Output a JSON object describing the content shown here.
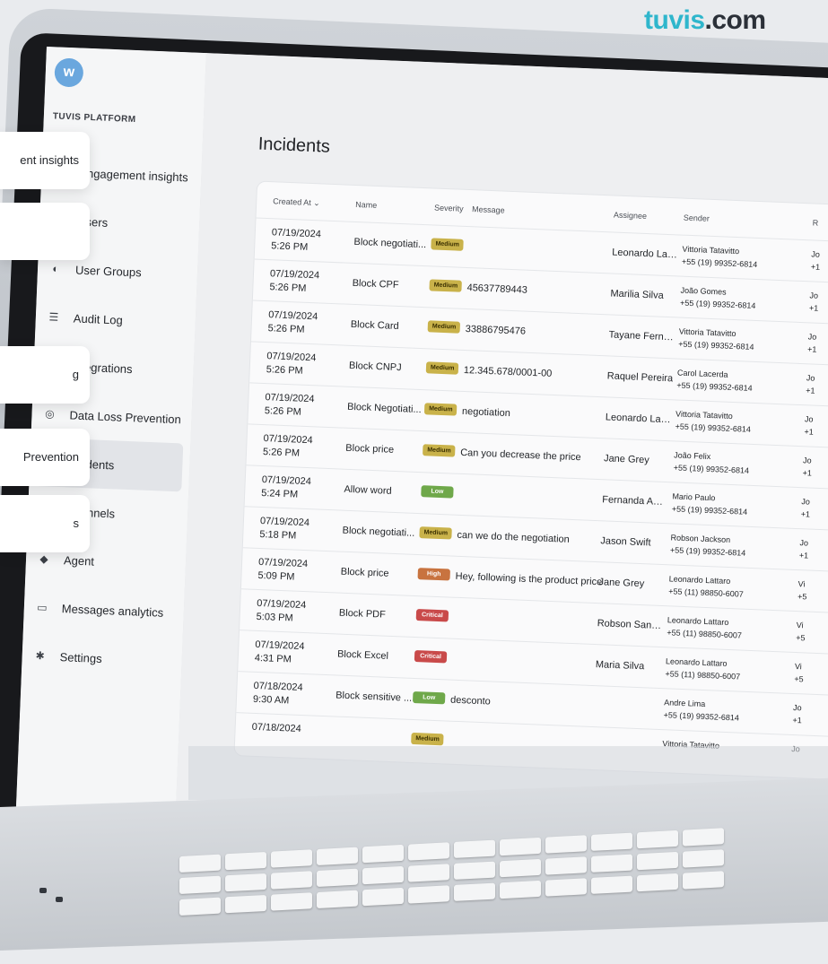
{
  "brand": {
    "part1": "tuvis",
    "part2": ".com"
  },
  "app": {
    "logo_glyph": "w",
    "platform": "TUVIS PLATFORM"
  },
  "nav": [
    {
      "icon": "chart-icon",
      "glyph": "▥",
      "label": "Engagement insights"
    },
    {
      "icon": "user-icon",
      "glyph": "●",
      "label": "Users"
    },
    {
      "icon": "users-icon",
      "glyph": "◐",
      "label": "User Groups"
    },
    {
      "icon": "list-icon",
      "glyph": "☰",
      "label": "Audit Log"
    },
    {
      "icon": "plug-icon",
      "glyph": "⊞",
      "label": "Integrations"
    },
    {
      "icon": "shield-icon",
      "glyph": "◎",
      "label": "Data Loss Prevention"
    },
    {
      "icon": "alert-icon",
      "glyph": "⚠",
      "label": "Incidents"
    },
    {
      "icon": "channel-icon",
      "glyph": "◇",
      "label": "Channels"
    },
    {
      "icon": "agent-icon",
      "glyph": "◆",
      "label": "Agent"
    },
    {
      "icon": "messages-icon",
      "glyph": "▭",
      "label": "Messages analytics"
    },
    {
      "icon": "gear-icon",
      "glyph": "✱",
      "label": "Settings"
    }
  ],
  "floats": [
    {
      "label": "ent insights"
    },
    {
      "label": ""
    },
    {
      "label": "g"
    },
    {
      "label": "Prevention"
    },
    {
      "label": "s"
    }
  ],
  "page": {
    "title": "Incidents"
  },
  "table": {
    "headers": {
      "created": "Created At ⌄",
      "name": "Name",
      "severity": "Severity",
      "message": "Message",
      "assignee": "Assignee",
      "sender": "Sender",
      "receiver": "R"
    },
    "rows": [
      {
        "date": "07/19/2024",
        "time": "5:26 PM",
        "name": "Block negotiati...",
        "sev": "Medium",
        "msg": "",
        "assignee": "Leonardo Latta...",
        "sender": "Vittoria Tatavitto",
        "sender_phone": "+55 (19) 99352-6814",
        "rcv1": "Jo",
        "rcv2": "+1"
      },
      {
        "date": "07/19/2024",
        "time": "5:26 PM",
        "name": "Block CPF",
        "sev": "Medium",
        "msg": "45637789443",
        "assignee": "Marilia Silva",
        "sender": "João Gomes",
        "sender_phone": "+55 (19) 99352-6814",
        "rcv1": "Jo",
        "rcv2": "+1"
      },
      {
        "date": "07/19/2024",
        "time": "5:26 PM",
        "name": "Block Card",
        "sev": "Medium",
        "msg": "33886795476",
        "assignee": "Tayane Fernan...",
        "sender": "Vittoria Tatavitto",
        "sender_phone": "+55 (19) 99352-6814",
        "rcv1": "Jo",
        "rcv2": "+1"
      },
      {
        "date": "07/19/2024",
        "time": "5:26 PM",
        "name": "Block CNPJ",
        "sev": "Medium",
        "msg": "12.345.678/0001-00",
        "assignee": "Raquel Pereira",
        "sender": "Carol Lacerda",
        "sender_phone": "+55 (19) 99352-6814",
        "rcv1": "Jo",
        "rcv2": "+1"
      },
      {
        "date": "07/19/2024",
        "time": "5:26 PM",
        "name": "Block Negotiati...",
        "sev": "Medium",
        "msg": "negotiation",
        "assignee": "Leonardo Latta...",
        "sender": "Vittoria Tatavitto",
        "sender_phone": "+55 (19) 99352-6814",
        "rcv1": "Jo",
        "rcv2": "+1"
      },
      {
        "date": "07/19/2024",
        "time": "5:26 PM",
        "name": "Block price",
        "sev": "Medium",
        "msg": "Can you decrease the price",
        "assignee": "Jane Grey",
        "sender": "João Felix",
        "sender_phone": "+55 (19) 99352-6814",
        "rcv1": "Jo",
        "rcv2": "+1"
      },
      {
        "date": "07/19/2024",
        "time": "5:24 PM",
        "name": "Allow word",
        "sev": "Low",
        "msg": "",
        "assignee": "Fernanda AAlves",
        "sender": "Mario Paulo",
        "sender_phone": "+55 (19) 99352-6814",
        "rcv1": "Jo",
        "rcv2": "+1"
      },
      {
        "date": "07/19/2024",
        "time": "5:18 PM",
        "name": "Block negotiati...",
        "sev": "Medium",
        "msg": "can we do the negotiation",
        "assignee": "Jason Swift",
        "sender": "Robson Jackson",
        "sender_phone": "+55 (19) 99352-6814",
        "rcv1": "Jo",
        "rcv2": "+1"
      },
      {
        "date": "07/19/2024",
        "time": "5:09 PM",
        "name": "Block price",
        "sev": "High",
        "msg": "Hey, following is the product price",
        "assignee": "Jane Grey",
        "sender": "Leonardo Lattaro",
        "sender_phone": "+55 (11) 98850-6007",
        "rcv1": "Vi",
        "rcv2": "+5"
      },
      {
        "date": "07/19/2024",
        "time": "5:03 PM",
        "name": "Block PDF",
        "sev": "Critical",
        "msg": "",
        "assignee": "Robson Santos",
        "sender": "Leonardo Lattaro",
        "sender_phone": "+55 (11) 98850-6007",
        "rcv1": "Vi",
        "rcv2": "+5"
      },
      {
        "date": "07/19/2024",
        "time": "4:31 PM",
        "name": "Block Excel",
        "sev": "Critical",
        "msg": "",
        "assignee": "Maria Silva",
        "sender": "Leonardo Lattaro",
        "sender_phone": "+55 (11) 98850-6007",
        "rcv1": "Vi",
        "rcv2": "+5"
      },
      {
        "date": "07/18/2024",
        "time": "9:30 AM",
        "name": "Block sensitive ...",
        "sev": "Low",
        "msg": "desconto",
        "assignee": "",
        "sender": "Andre Lima",
        "sender_phone": "+55 (19) 99352-6814",
        "rcv1": "Jo",
        "rcv2": "+1"
      },
      {
        "date": "07/18/2024",
        "time": "",
        "name": "",
        "sev": "Medium",
        "msg": "",
        "assignee": "",
        "sender": "Vittoria Tatavitto",
        "sender_phone": "",
        "rcv1": "Jo",
        "rcv2": ""
      }
    ]
  },
  "severity_colors": {
    "Medium": {
      "bg": "#c9b24a",
      "fg": "#3a2f00"
    },
    "Low": {
      "bg": "#6fa84a",
      "fg": "#ffffff"
    },
    "High": {
      "bg": "#c8733f",
      "fg": "#ffffff"
    },
    "Critical": {
      "bg": "#c94a4a",
      "fg": "#ffffff"
    }
  }
}
